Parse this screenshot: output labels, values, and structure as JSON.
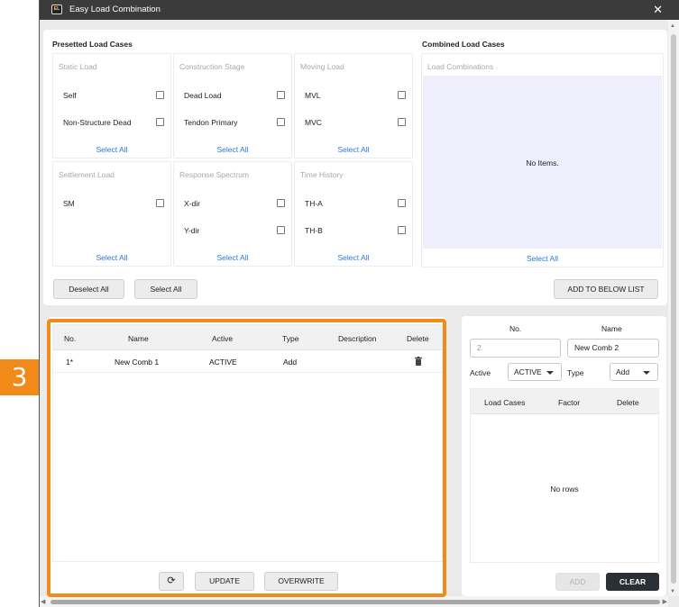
{
  "step_badge": "3",
  "window": {
    "title": "Easy Load Combination",
    "app_icon_text": "EL"
  },
  "presetted": {
    "title": "Presetted Load Cases",
    "select_all_label": "Select All",
    "groups": [
      {
        "title": "Static Load",
        "items": [
          "Self",
          "Non-Structure Dead"
        ]
      },
      {
        "title": "Construction Stage",
        "items": [
          "Dead Load",
          "Tendon Primary"
        ]
      },
      {
        "title": "Moving Load",
        "items": [
          "MVL",
          "MVC"
        ]
      },
      {
        "title": "Settlement Load",
        "items": [
          "SM"
        ]
      },
      {
        "title": "Response Spectrum",
        "items": [
          "X-dir",
          "Y-dir"
        ]
      },
      {
        "title": "Time History",
        "items": [
          "TH-A",
          "TH-B"
        ]
      }
    ]
  },
  "combined": {
    "title": "Combined Load Cases",
    "list_title": "Load Combinations",
    "empty_text": "No Items.",
    "select_all_label": "Select All"
  },
  "top_buttons": {
    "deselect_all": "Deselect All",
    "select_all": "Select All",
    "add_to_list": "ADD TO BELOW LIST"
  },
  "comb_table": {
    "headers": [
      "No.",
      "Name",
      "Active",
      "Type",
      "Description",
      "Delete"
    ],
    "rows": [
      {
        "no": "1*",
        "name": "New Comb 1",
        "active": "ACTIVE",
        "type": "Add",
        "description": ""
      }
    ]
  },
  "bottom_buttons": {
    "update": "UPDATE",
    "overwrite": "OVERWRITE"
  },
  "editor": {
    "no_label": "No.",
    "name_label": "Name",
    "no_value": "2",
    "name_value": "New Comb 2",
    "active_label": "Active",
    "active_value": "ACTIVE",
    "type_label": "Type",
    "type_value": "Add",
    "headers": [
      "Load Cases",
      "Factor",
      "Delete"
    ],
    "empty_text": "No rows",
    "add_label": "ADD",
    "clear_label": "CLEAR"
  },
  "colors": {
    "accent_orange": "#f28a19",
    "link_blue": "#2a7ad6",
    "dark_button": "#2b2f36",
    "list_bg": "#efeefd"
  }
}
